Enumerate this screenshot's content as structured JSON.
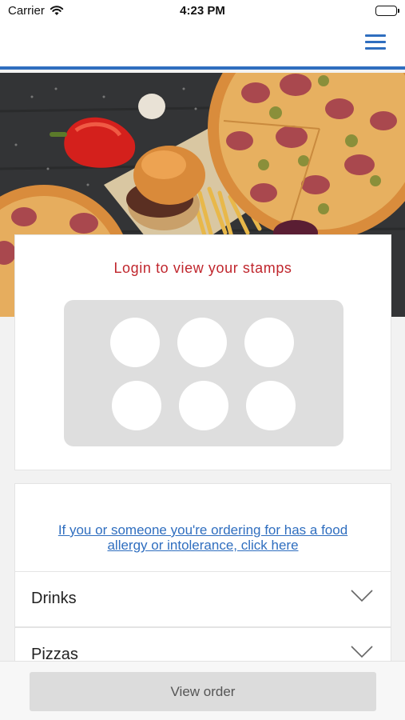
{
  "status_bar": {
    "carrier": "Carrier",
    "time": "4:23 PM"
  },
  "nav": {
    "menu_icon": "hamburger-menu-icon"
  },
  "hero": {
    "image": "food-banner-pizza-burger-fries"
  },
  "stamps": {
    "title": "Login to view your stamps",
    "count": 6
  },
  "allergy": {
    "line1": "If you or someone you're ordering for has a food",
    "line2": "allergy or intolerance, click here"
  },
  "categories": [
    {
      "label": "Drinks",
      "icon": "chevron-down-icon"
    },
    {
      "label": "Pizzas",
      "icon": "chevron-down-icon"
    }
  ],
  "footer": {
    "view_order_label": "View order"
  },
  "colors": {
    "accent_blue": "#2f6ebf",
    "stamp_title_red": "#c0262d"
  }
}
